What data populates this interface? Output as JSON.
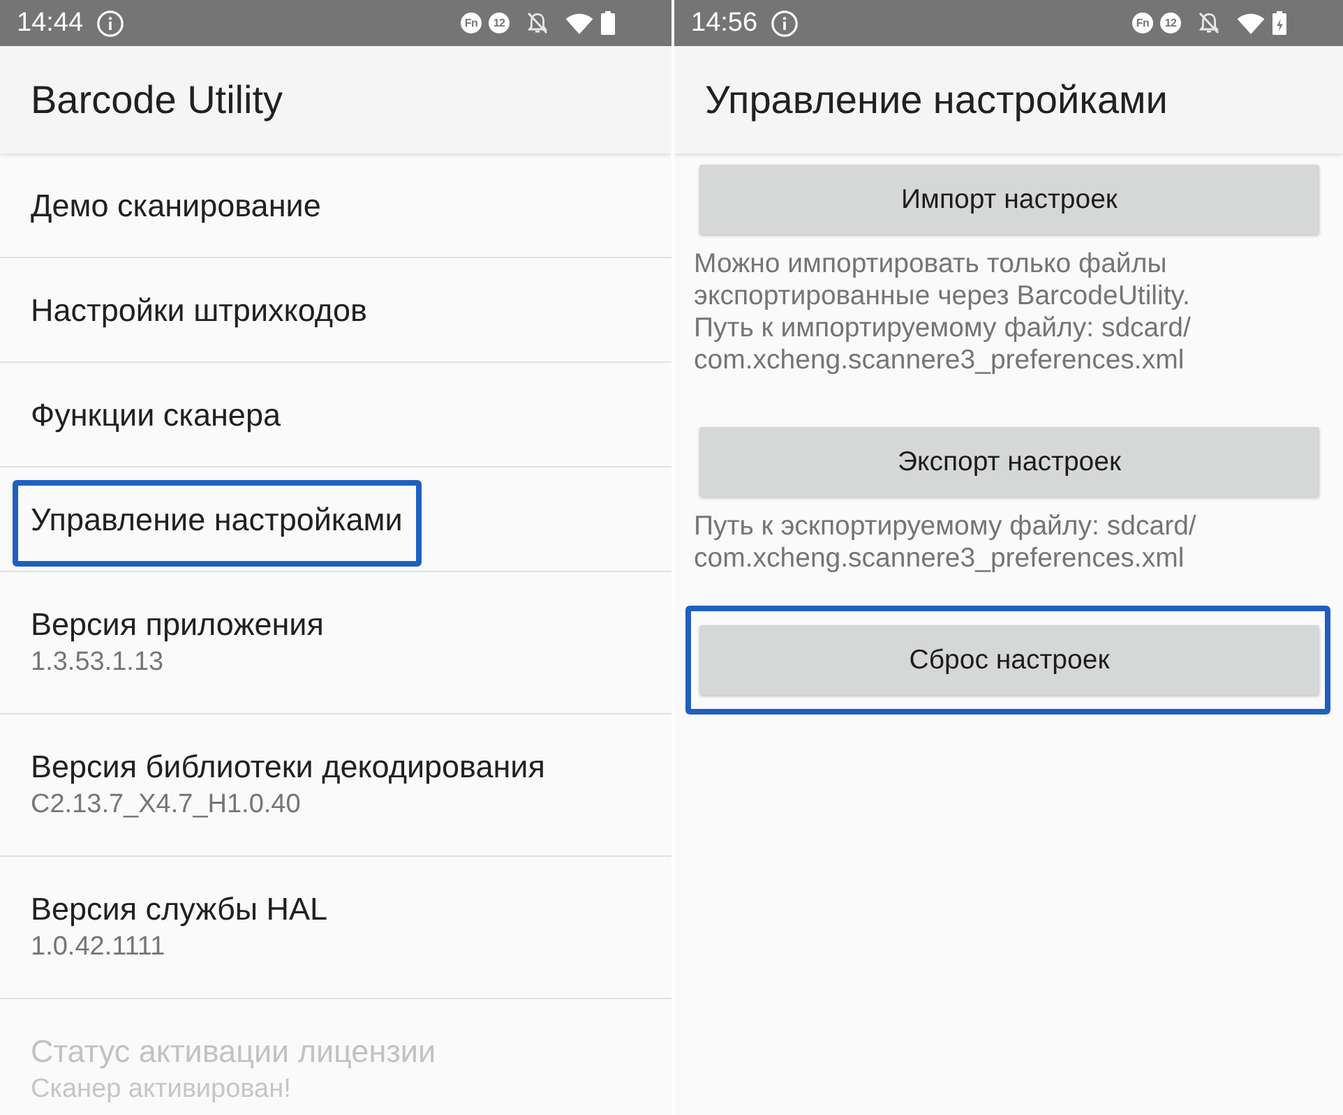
{
  "screens": [
    {
      "kind": "menu",
      "status_bar": {
        "time": "14:44",
        "badges": [
          "Fn",
          "12"
        ],
        "charging": false
      },
      "title": "Barcode Utility",
      "items": [
        {
          "title": "Демо сканирование",
          "highlighted": false,
          "disabled": false
        },
        {
          "title": "Настройки штрихкодов",
          "highlighted": false,
          "disabled": false
        },
        {
          "title": "Функции сканера",
          "highlighted": false,
          "disabled": false
        },
        {
          "title": "Управление настройками",
          "highlighted": true,
          "disabled": false
        },
        {
          "title": "Версия приложения",
          "subtitle": "1.3.53.1.13",
          "highlighted": false,
          "disabled": false
        },
        {
          "title": "Версия библиотеки декодирования",
          "subtitle": "C2.13.7_X4.7_H1.0.40",
          "highlighted": false,
          "disabled": false
        },
        {
          "title": "Версия службы HAL",
          "subtitle": "1.0.42.1111",
          "highlighted": false,
          "disabled": false
        },
        {
          "title": "Статус активации лицензии",
          "subtitle": "Сканер активирован!",
          "highlighted": false,
          "disabled": true
        }
      ]
    },
    {
      "kind": "settings",
      "status_bar": {
        "time": "14:56",
        "badges": [
          "Fn",
          "12"
        ],
        "charging": true
      },
      "title": "Управление настройками",
      "sections": [
        {
          "button": "Импорт настроек",
          "description": "Можно импортировать только файлы\nэкспортированные через BarcodeUtility.\nПуть к импортируемому файлу: sdcard/\ncom.xcheng.scannere3_preferences.xml",
          "highlighted": false
        },
        {
          "button": "Экспорт настроек",
          "description": "Путь к эскпортируемому файлу: sdcard/\ncom.xcheng.scannere3_preferences.xml",
          "highlighted": false
        },
        {
          "button": "Сброс настроек",
          "highlighted": true
        }
      ]
    }
  ]
}
